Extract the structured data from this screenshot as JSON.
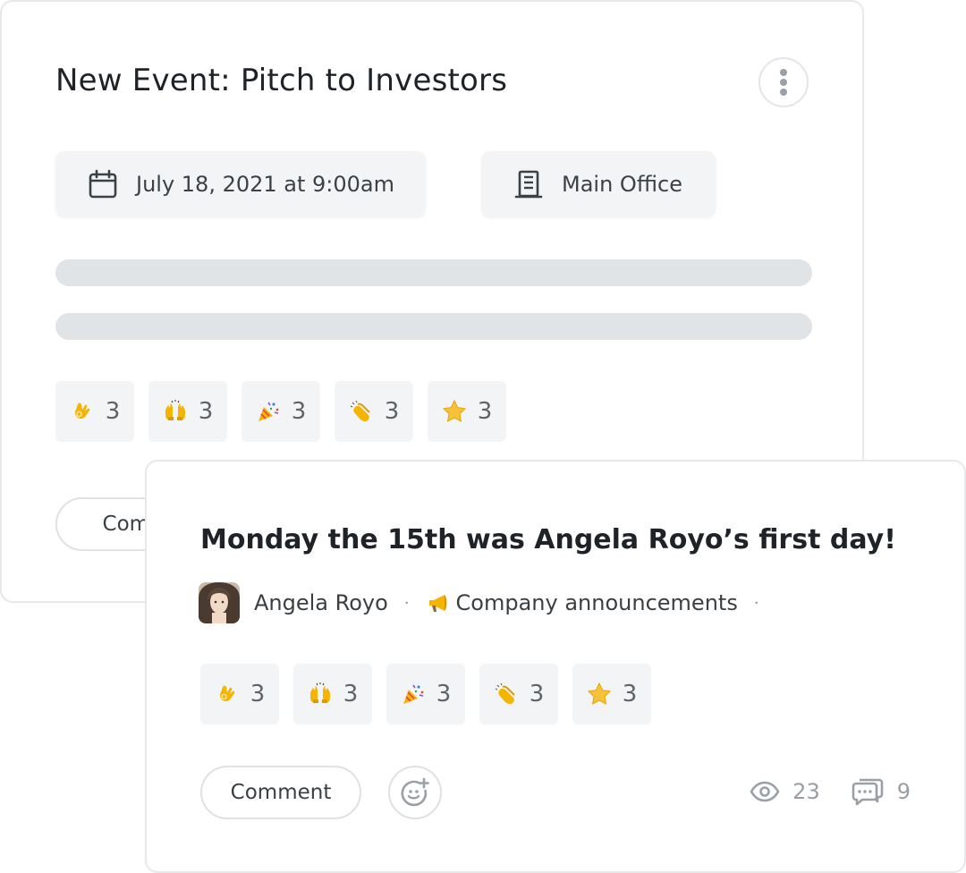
{
  "event_card": {
    "title": "New Event: Pitch to Investors",
    "more_icon": "more-vertical-icon",
    "date": {
      "icon": "calendar-icon",
      "text": "July 18, 2021 at 9:00am"
    },
    "location": {
      "icon": "building-icon",
      "text": "Main Office"
    },
    "reactions": [
      {
        "emoji": "ok-hand",
        "count": "3"
      },
      {
        "emoji": "raising-hands",
        "count": "3"
      },
      {
        "emoji": "party-popper",
        "count": "3"
      },
      {
        "emoji": "clapping-hands",
        "count": "3"
      },
      {
        "emoji": "star",
        "count": "3"
      }
    ],
    "comment_label": "Comm"
  },
  "post_card": {
    "title": "Monday the 15th was Angela Royo’s first day!",
    "author": "Angela Royo",
    "separator": "·",
    "channel_icon": "megaphone-icon",
    "channel": "Company announcements",
    "reactions": [
      {
        "emoji": "ok-hand",
        "count": "3"
      },
      {
        "emoji": "raising-hands",
        "count": "3"
      },
      {
        "emoji": "party-popper",
        "count": "3"
      },
      {
        "emoji": "clapping-hands",
        "count": "3"
      },
      {
        "emoji": "star",
        "count": "3"
      }
    ],
    "comment_label": "Comment",
    "add_reaction_icon": "add-emoji-icon",
    "views": {
      "icon": "eye-icon",
      "count": "23"
    },
    "comments": {
      "icon": "comments-icon",
      "count": "9"
    }
  },
  "colors": {
    "chip_bg": "#f3f4f6",
    "skeleton": "#e1e4e7",
    "border": "#e6e8eb",
    "emoji_yellow": "#f7c23a"
  }
}
